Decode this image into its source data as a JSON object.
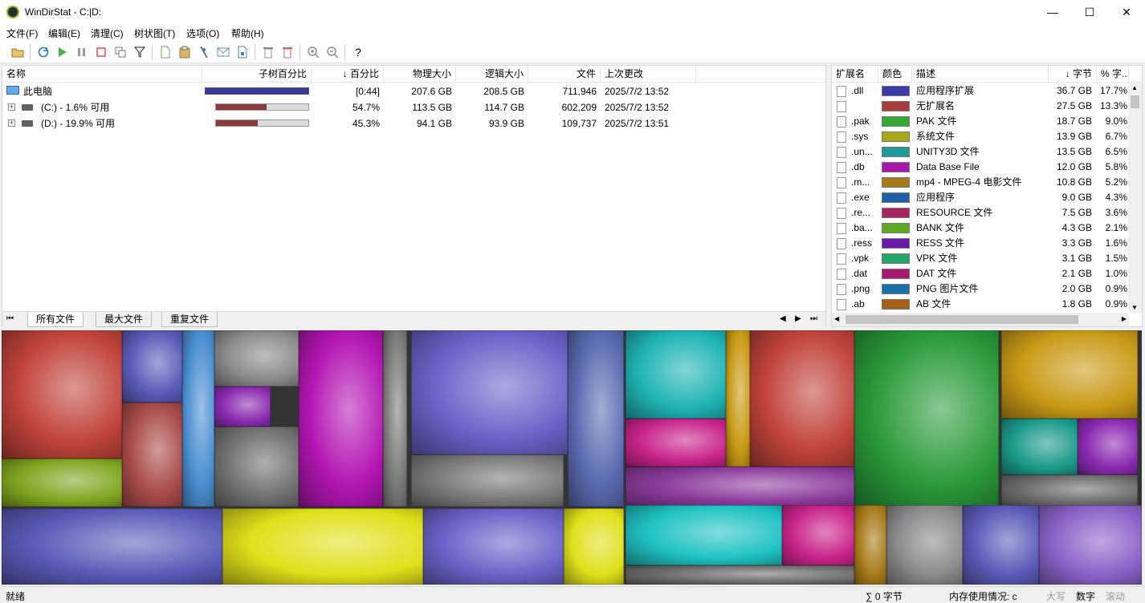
{
  "window": {
    "title": "WinDirStat - C:|D:"
  },
  "menu": [
    "文件(F)",
    "编辑(E)",
    "清理(C)",
    "树状图(T)",
    "选项(O)",
    "帮助(H)"
  ],
  "tree": {
    "headers": {
      "name": "名称",
      "subtree": "子树百分比",
      "percent": "↓ 百分比",
      "physical": "物理大小",
      "logical": "逻辑大小",
      "files": "文件",
      "modified": "上次更改"
    },
    "rows": [
      {
        "name": "此电脑",
        "bar_fraction": 1.0,
        "bar_color": "#3a3a9a",
        "percent": "[0:44]",
        "physical": "207.6 GB",
        "logical": "208.5 GB",
        "files": "711,946",
        "modified": "2025/7/2  13:52"
      },
      {
        "name": "(C:) - 1.6% 可用",
        "bar_fraction": 0.547,
        "bar_color": "#8a3a3a",
        "percent": "54.7%",
        "physical": "113.5 GB",
        "logical": "114.7 GB",
        "files": "602,209",
        "modified": "2025/7/2  13:52"
      },
      {
        "name": "(D:) - 19.9% 可用",
        "bar_fraction": 0.453,
        "bar_color": "#8a3a3a",
        "percent": "45.3%",
        "physical": "94.1 GB",
        "logical": "93.9 GB",
        "files": "109,737",
        "modified": "2025/7/2  13:51"
      }
    ],
    "tabs": [
      "所有文件",
      "最大文件",
      "重复文件"
    ]
  },
  "extensions": {
    "headers": {
      "ext": "扩展名",
      "color": "颜色",
      "desc": "描述",
      "bytes": "↓ 字节",
      "pct": "% 字..."
    },
    "rows": [
      {
        "ext": ".dll",
        "color": "#3b3ba8",
        "desc": "应用程序扩展",
        "bytes": "36.7 GB",
        "pct": "17.7%"
      },
      {
        "ext": "",
        "color": "#a83b3b",
        "desc": "无扩展名",
        "bytes": "27.5 GB",
        "pct": "13.3%"
      },
      {
        "ext": ".pak",
        "color": "#33a833",
        "desc": "PAK 文件",
        "bytes": "18.7 GB",
        "pct": "9.0%"
      },
      {
        "ext": ".sys",
        "color": "#a8a819",
        "desc": "系统文件",
        "bytes": "13.9 GB",
        "pct": "6.7%"
      },
      {
        "ext": ".un...",
        "color": "#1f9a9a",
        "desc": "UNITY3D 文件",
        "bytes": "13.5 GB",
        "pct": "6.5%"
      },
      {
        "ext": ".db",
        "color": "#a819a8",
        "desc": "Data Base File",
        "bytes": "12.0 GB",
        "pct": "5.8%"
      },
      {
        "ext": ".m...",
        "color": "#a87a19",
        "desc": "mp4 - MPEG-4 电影文件",
        "bytes": "10.8 GB",
        "pct": "5.2%"
      },
      {
        "ext": ".exe",
        "color": "#1f5fa8",
        "desc": "应用程序",
        "bytes": "9.0 GB",
        "pct": "4.3%"
      },
      {
        "ext": ".re...",
        "color": "#a8245f",
        "desc": "RESOURCE 文件",
        "bytes": "7.5 GB",
        "pct": "3.6%"
      },
      {
        "ext": ".ba...",
        "color": "#5fa824",
        "desc": "BANK 文件",
        "bytes": "4.3 GB",
        "pct": "2.1%"
      },
      {
        "ext": ".ress",
        "color": "#6a19a8",
        "desc": "RESS 文件",
        "bytes": "3.3 GB",
        "pct": "1.6%"
      },
      {
        "ext": ".vpk",
        "color": "#24a86a",
        "desc": "VPK 文件",
        "bytes": "3.1 GB",
        "pct": "1.5%"
      },
      {
        "ext": ".dat",
        "color": "#a81970",
        "desc": "DAT 文件",
        "bytes": "2.1 GB",
        "pct": "1.0%"
      },
      {
        "ext": ".png",
        "color": "#1970a8",
        "desc": "PNG 图片文件",
        "bytes": "2.0 GB",
        "pct": "0.9%"
      },
      {
        "ext": ".ab",
        "color": "#a86019",
        "desc": "AB 文件",
        "bytes": "1.8 GB",
        "pct": "0.9%"
      }
    ]
  },
  "status": {
    "ready": "就绪",
    "sum": "∑ 0 字节",
    "memory": "内存使用情况: c",
    "caps": "大写",
    "num": "数字",
    "scroll": "滚动"
  },
  "toolbar_icons": [
    "open-icon",
    "refresh-icon",
    "play-icon",
    "pause-icon",
    "stop-icon",
    "copy-icon",
    "filter-icon",
    "new-file-icon",
    "paste-icon",
    "cleanup-icon",
    "email-icon",
    "properties-icon",
    "delete-icon",
    "delete-permanent-icon",
    "zoom-in-icon",
    "zoom-out-icon",
    "help-icon"
  ]
}
